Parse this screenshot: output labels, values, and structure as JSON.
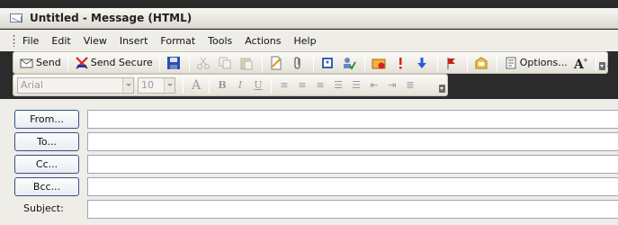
{
  "window": {
    "title": "Untitled - Message (HTML)"
  },
  "menu": {
    "items": [
      {
        "label": "File"
      },
      {
        "label": "Edit"
      },
      {
        "label": "View"
      },
      {
        "label": "Insert"
      },
      {
        "label": "Format"
      },
      {
        "label": "Tools"
      },
      {
        "label": "Actions"
      },
      {
        "label": "Help"
      }
    ]
  },
  "toolbar": {
    "send_label": "Send",
    "send_secure_label": "Send Secure",
    "options_label": "Options..."
  },
  "format_toolbar": {
    "font_value": "Arial",
    "size_value": "10"
  },
  "header_fields": {
    "from_label": "From...",
    "to_label": "To...",
    "cc_label": "Cc...",
    "bcc_label": "Bcc...",
    "subject_label": "Subject:",
    "from_value": "",
    "to_value": "",
    "cc_value": "",
    "bcc_value": "",
    "subject_value": ""
  },
  "colors": {
    "background": "#efede7",
    "button_border": "#375089",
    "accent": "#2c58b0"
  }
}
